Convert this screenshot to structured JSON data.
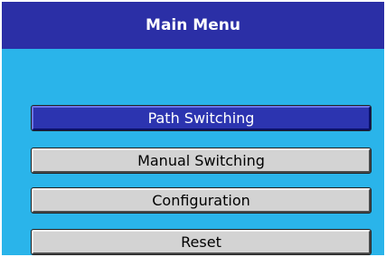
{
  "title": "Main Menu",
  "menu": {
    "selected_index": 0,
    "items": [
      {
        "label": "Path Switching"
      },
      {
        "label": "Manual Switching"
      },
      {
        "label": "Configuration"
      },
      {
        "label": "Reset"
      }
    ]
  },
  "colors": {
    "title_bar": "#2b2fa6",
    "background": "#2ab4ea",
    "button": "#d3d3d3",
    "button_selected": "#2c34b0"
  }
}
